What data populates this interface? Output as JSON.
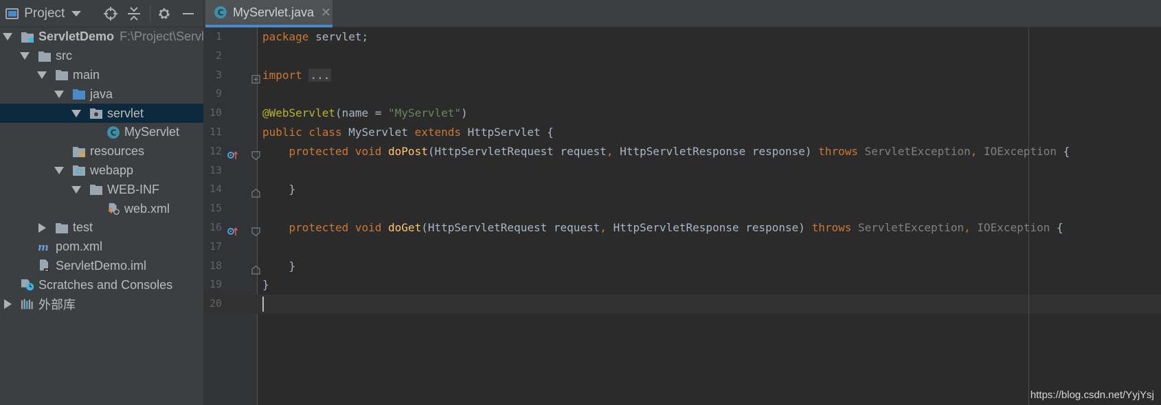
{
  "project_panel": {
    "title": "Project",
    "tree": [
      {
        "label": "ServletDemo",
        "hint": "F:\\Project\\Servlet",
        "icon": "module-folder-icon",
        "arrow": "down",
        "depth": 0,
        "bold": true
      },
      {
        "label": "src",
        "icon": "folder-icon",
        "arrow": "down",
        "depth": 1
      },
      {
        "label": "main",
        "icon": "folder-icon",
        "arrow": "down",
        "depth": 2
      },
      {
        "label": "java",
        "icon": "source-folder-icon",
        "arrow": "down",
        "depth": 3
      },
      {
        "label": "servlet",
        "icon": "package-icon",
        "arrow": "down",
        "depth": 4,
        "selected": true
      },
      {
        "label": "MyServlet",
        "icon": "java-class-icon",
        "arrow": "none",
        "depth": 5
      },
      {
        "label": "resources",
        "icon": "resources-folder-icon",
        "arrow": "none",
        "depth": 3
      },
      {
        "label": "webapp",
        "icon": "web-folder-icon",
        "arrow": "down",
        "depth": 3
      },
      {
        "label": "WEB-INF",
        "icon": "folder-icon",
        "arrow": "down",
        "depth": 4
      },
      {
        "label": "web.xml",
        "icon": "xml-file-icon",
        "arrow": "none",
        "depth": 5
      },
      {
        "label": "test",
        "icon": "folder-icon",
        "arrow": "right",
        "depth": 2
      },
      {
        "label": "pom.xml",
        "icon": "maven-icon",
        "arrow": "none",
        "depth": 1
      },
      {
        "label": "ServletDemo.iml",
        "icon": "iml-file-icon",
        "arrow": "none",
        "depth": 1
      },
      {
        "label": "Scratches and Consoles",
        "icon": "scratches-icon",
        "arrow": "none",
        "depth": 0
      },
      {
        "label": "外部库",
        "icon": "libraries-icon",
        "arrow": "right",
        "depth": 0
      }
    ]
  },
  "editor": {
    "tab_label": "MyServlet.java",
    "lines": [
      {
        "num": "1"
      },
      {
        "num": "2"
      },
      {
        "num": "3"
      },
      {
        "num": "9"
      },
      {
        "num": "10"
      },
      {
        "num": "11"
      },
      {
        "num": "12"
      },
      {
        "num": "13"
      },
      {
        "num": "14"
      },
      {
        "num": "15"
      },
      {
        "num": "16"
      },
      {
        "num": "17"
      },
      {
        "num": "18"
      },
      {
        "num": "19"
      },
      {
        "num": "20"
      }
    ],
    "tokens": {
      "package_kw": "package",
      "package_name": " servlet;",
      "import_kw": "import",
      "import_folded": "...",
      "annotation": "@WebServlet",
      "ann_open": "(",
      "ann_param": "name",
      "ann_eq": " = ",
      "ann_value": "\"MyServlet\"",
      "ann_close": ")",
      "class_decl_kw": "public class",
      "class_name": " MyServlet ",
      "extends_kw": "extends",
      "super_class": " HttpServlet {",
      "indent": "    ",
      "protected_void": "protected void",
      "do_post": "doPost",
      "do_get": "doGet",
      "param1": "(HttpServletRequest request",
      "comma": ",",
      "param2": " HttpServletResponse response) ",
      "throws_kw": "throws",
      "ex1": " ServletException",
      "ex2": " IOException",
      "open_brace": " {",
      "method_close": "    }",
      "class_close": "}"
    }
  },
  "watermark": "https://blog.csdn.net/YyjYsj"
}
